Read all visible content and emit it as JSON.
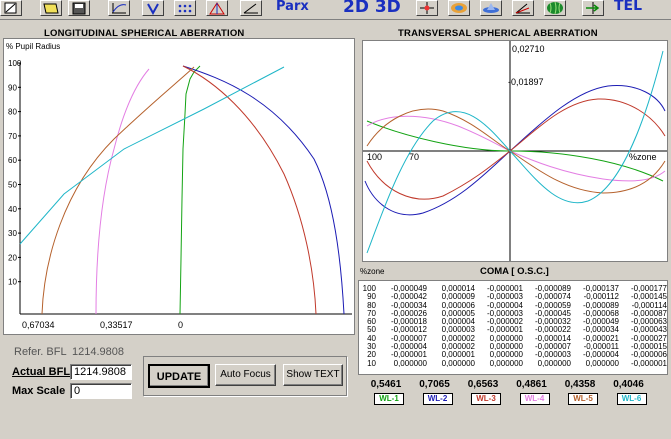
{
  "toolbar": {
    "text_buttons": [
      "Parx",
      "2D 3D",
      "TEL"
    ],
    "icons": [
      "square-icon",
      "folder-icon",
      "save-icon",
      "function-graph-icon",
      "vector-icon",
      "dot-grid-icon",
      "triangle-ray-icon",
      "angle-icon",
      "star-icon",
      "surface-icon",
      "lens-icon",
      "ray-angle-icon",
      "watermelon-icon",
      "arrow-in-icon"
    ]
  },
  "longitudinal": {
    "title": "LONGITUDINAL SPHERICAL  ABERRATION",
    "y_label": "% Pupil Radius",
    "y_ticks": [
      "100",
      "90",
      "80",
      "70",
      "60",
      "50",
      "40",
      "30",
      "20",
      "10"
    ],
    "x_ticks": [
      "0,67034",
      "0,33517",
      "0"
    ]
  },
  "transversal": {
    "title": "TRANSVERSAL SPHERICAL  ABERRATION",
    "top_value": "0,02710",
    "mid_value": "-0,01897",
    "left_label_a": "100",
    "left_label_b": "70",
    "right_label": "%zone"
  },
  "coma": {
    "zone_label": "%zone",
    "title": "COMA [ O.S.C.]",
    "rows": [
      {
        "zone": "100",
        "values": [
          "-0,000049",
          "0,000014",
          "-0,000001",
          "-0,000089",
          "-0,000137",
          "-0,000177"
        ]
      },
      {
        "zone": "90",
        "values": [
          "-0,000042",
          "0,000009",
          "-0,000003",
          "-0,000074",
          "-0,000112",
          "-0,000145"
        ]
      },
      {
        "zone": "80",
        "values": [
          "-0,000034",
          "0,000006",
          "-0,000004",
          "-0,000059",
          "-0,000089",
          "-0,000114"
        ]
      },
      {
        "zone": "70",
        "values": [
          "-0,000026",
          "0,000005",
          "-0,000003",
          "-0,000045",
          "-0,000068",
          "-0,000087"
        ]
      },
      {
        "zone": "60",
        "values": [
          "-0,000018",
          "0,000004",
          "-0,000002",
          "-0,000032",
          "-0,000049",
          "-0,000063"
        ]
      },
      {
        "zone": "50",
        "values": [
          "-0,000012",
          "0,000003",
          "-0,000001",
          "-0,000022",
          "-0,000034",
          "-0,000043"
        ]
      },
      {
        "zone": "40",
        "values": [
          "-0,000007",
          "0,000002",
          "0,000000",
          "-0,000014",
          "-0,000021",
          "-0,000027"
        ]
      },
      {
        "zone": "30",
        "values": [
          "-0,000004",
          "0,000002",
          "0,000000",
          "-0,000007",
          "-0,000011",
          "-0,000015"
        ]
      },
      {
        "zone": "20",
        "values": [
          "-0,000001",
          "0,000001",
          "0,000000",
          "-0,000003",
          "-0,000004",
          "-0,000006"
        ]
      },
      {
        "zone": "10",
        "values": [
          "0,000000",
          "0,000000",
          "0,000000",
          "0,000000",
          "0,000000",
          "-0,000001"
        ]
      }
    ]
  },
  "wavelengths": [
    {
      "value": "0,5461",
      "label": "WL-1",
      "color": "#13a313"
    },
    {
      "value": "0,7065",
      "label": "WL-2",
      "color": "#1c1cb4"
    },
    {
      "value": "0,6563",
      "label": "WL-3",
      "color": "#c0392b"
    },
    {
      "value": "0,4861",
      "label": "WL-4",
      "color": "#e37ee3"
    },
    {
      "value": "0,4358",
      "label": "WL-5",
      "color": "#b5612c"
    },
    {
      "value": "0,4046",
      "label": "WL-6",
      "color": "#1fb6c8"
    }
  ],
  "controls": {
    "refer_label": "Refer.  BFL",
    "refer_value": "1214.9808",
    "actual_bfl_label": "Actual BFL",
    "actual_bfl_value": "1214.9808",
    "max_scale_label": "Max Scale",
    "max_scale_value": "0",
    "update_label": "UPDATE",
    "autofocus_label": "Auto Focus",
    "showtext_label": "Show TEXT"
  }
}
